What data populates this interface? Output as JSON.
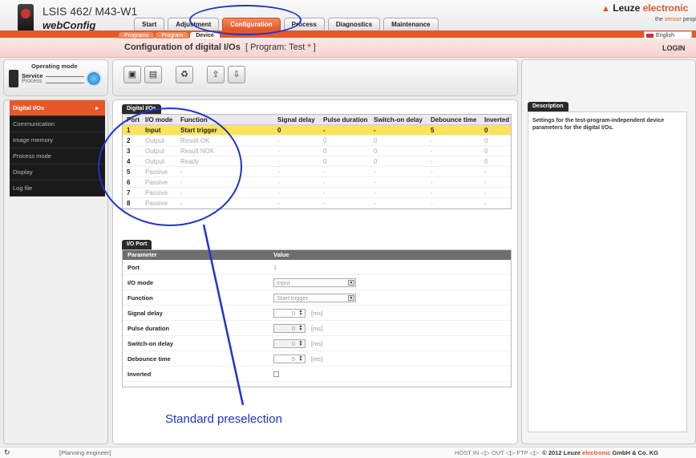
{
  "app": {
    "product_title": "LSIS 462",
    "product_title_suffix": "i",
    "product_title_rest": " M43-W1",
    "subtitle": "webConfig",
    "brand": "Leuze electronic",
    "brand_word1": "Leuze",
    "brand_word2": "electronic",
    "slogan_pre": "the",
    "slogan_accent": "sensor",
    "slogan_post": "people",
    "language": "English",
    "login_label": "LOGIN"
  },
  "main_tabs": [
    {
      "label": "Start"
    },
    {
      "label": "Adjustment"
    },
    {
      "label": "Configuration",
      "active": true
    },
    {
      "label": "Process"
    },
    {
      "label": "Diagnostics"
    },
    {
      "label": "Maintenance"
    }
  ],
  "sub_tabs": [
    {
      "label": "Programs"
    },
    {
      "label": "Program"
    },
    {
      "label": "Device",
      "active": true
    }
  ],
  "page": {
    "title": "Configuration of digital I/Os",
    "program_label": "[ Program: Test",
    "program_star": "*",
    "program_close": "]"
  },
  "operating_mode": {
    "title": "Operating mode",
    "service": "Service",
    "process": "Process"
  },
  "sidebar": {
    "items": [
      {
        "label": "Digital I/Os",
        "active": true
      },
      {
        "label": "Communication"
      },
      {
        "label": "Image memory"
      },
      {
        "label": "Process mode"
      },
      {
        "label": "Display"
      },
      {
        "label": "Log file"
      }
    ]
  },
  "toolbar": {
    "buttons": [
      "save-icon",
      "load-icon",
      "recycle-icon",
      "upload-icon",
      "download-icon"
    ]
  },
  "digital_ios": {
    "section_title": "Digital I/Os",
    "columns": [
      "Port",
      "I/O mode",
      "Function",
      "Signal delay",
      "Pulse duration",
      "Switch-on delay",
      "Debounce time",
      "Inverted"
    ],
    "rows": [
      {
        "port": "1",
        "mode": "Input",
        "function": "Start trigger",
        "signal_delay": "0",
        "pulse": "-",
        "switch_on": "-",
        "debounce": "5",
        "inverted": "0",
        "selected": true
      },
      {
        "port": "2",
        "mode": "Output",
        "function": "Result OK",
        "signal_delay": "-",
        "pulse": "0",
        "switch_on": "0",
        "debounce": "-",
        "inverted": "0"
      },
      {
        "port": "3",
        "mode": "Output",
        "function": "Result NOK",
        "signal_delay": "-",
        "pulse": "0",
        "switch_on": "0",
        "debounce": "-",
        "inverted": "0"
      },
      {
        "port": "4",
        "mode": "Output",
        "function": "Ready",
        "signal_delay": "-",
        "pulse": "0",
        "switch_on": "0",
        "debounce": "-",
        "inverted": "0"
      },
      {
        "port": "5",
        "mode": "Passive",
        "function": "-",
        "signal_delay": "-",
        "pulse": "-",
        "switch_on": "-",
        "debounce": "-",
        "inverted": "-"
      },
      {
        "port": "6",
        "mode": "Passive",
        "function": "-",
        "signal_delay": "-",
        "pulse": "-",
        "switch_on": "-",
        "debounce": "-",
        "inverted": "-"
      },
      {
        "port": "7",
        "mode": "Passive",
        "function": "-",
        "signal_delay": "-",
        "pulse": "-",
        "switch_on": "-",
        "debounce": "-",
        "inverted": "-"
      },
      {
        "port": "8",
        "mode": "Passive",
        "function": "-",
        "signal_delay": "-",
        "pulse": "-",
        "switch_on": "-",
        "debounce": "-",
        "inverted": "-"
      }
    ]
  },
  "io_port": {
    "section_title": "I/O Port",
    "col_parameter": "Parameter",
    "col_value": "Value",
    "port_label": "Port",
    "port_value": "1",
    "io_mode_label": "I/O mode",
    "io_mode_value": "Input",
    "function_label": "Function",
    "function_value": "Start trigger",
    "signal_delay_label": "Signal delay",
    "signal_delay_value": "0",
    "pulse_duration_label": "Pulse duration",
    "pulse_duration_value": "0",
    "switch_on_label": "Switch-on delay",
    "switch_on_value": "0",
    "debounce_label": "Debounce time",
    "debounce_value": "5",
    "inverted_label": "Inverted",
    "unit": "[ms]"
  },
  "description": {
    "title": "Description",
    "text": "Settings for the test-program-independent device parameters for the digital I/Os."
  },
  "annotation": {
    "text": "Standard preselection",
    "color": "#1f35c9"
  },
  "status": {
    "role": "[Planning engineer]",
    "host_in": "HOST IN",
    "out": "OUT",
    "ftp": "FTP",
    "copyright": "© 2012 Leuze",
    "copyright_accent": "electronic",
    "copyright_end": "GmbH & Co. KG"
  },
  "colors": {
    "accent": "#e8572a",
    "selected_row": "#fde35a"
  }
}
